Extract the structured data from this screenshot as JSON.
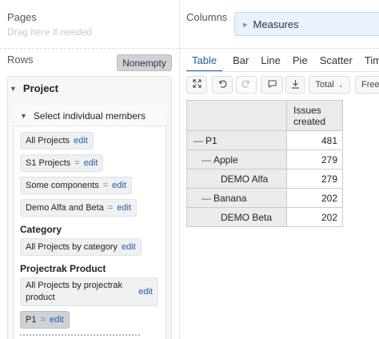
{
  "pages": {
    "title": "Pages",
    "hint": "Drag here if needed"
  },
  "columns": {
    "title": "Columns",
    "measures_label": "Measures"
  },
  "rows": {
    "title": "Rows",
    "nonempty_label": "Nonempty",
    "project_label": "Project",
    "members_label": "Select individual members",
    "chips": [
      {
        "text": "All Projects",
        "eq": false,
        "edit": "edit"
      },
      {
        "text": "S1 Projects",
        "eq": true,
        "edit": "edit"
      },
      {
        "text": "Some components",
        "eq": true,
        "edit": "edit"
      },
      {
        "text": "Demo Alfa and Beta",
        "eq": true,
        "edit": "edit"
      }
    ],
    "category_label": "Category",
    "category_chip": {
      "text": "All Projects by category",
      "edit": "edit"
    },
    "projectrak_label": "Projectrak Product",
    "projectrak_chip": {
      "line1": "All Projects by projectrak",
      "line2": "product",
      "edit": "edit"
    },
    "selected_chip": {
      "text": "P1",
      "edit": "edit"
    }
  },
  "tabs": [
    "Table",
    "Bar",
    "Line",
    "Pie",
    "Scatter",
    "Tim"
  ],
  "active_tab": "Table",
  "toolbar": {
    "expand_icon": "expand-icon",
    "undo_icon": "undo-icon",
    "redo_icon": "redo-icon",
    "comment_icon": "comment-icon",
    "export_icon": "export-icon",
    "total_label": "Total",
    "free_label": "Free"
  },
  "table": {
    "header_line1": "Issues",
    "header_line2": "created",
    "rows": [
      {
        "label": "P1",
        "value": "481",
        "minus": "—"
      },
      {
        "label": "Apple",
        "value": "279",
        "minus": "—"
      },
      {
        "label": "DEMO Alfa",
        "value": "279",
        "minus": ""
      },
      {
        "label": "Banana",
        "value": "202",
        "minus": "—"
      },
      {
        "label": "DEMO Beta",
        "value": "202",
        "minus": ""
      }
    ]
  }
}
